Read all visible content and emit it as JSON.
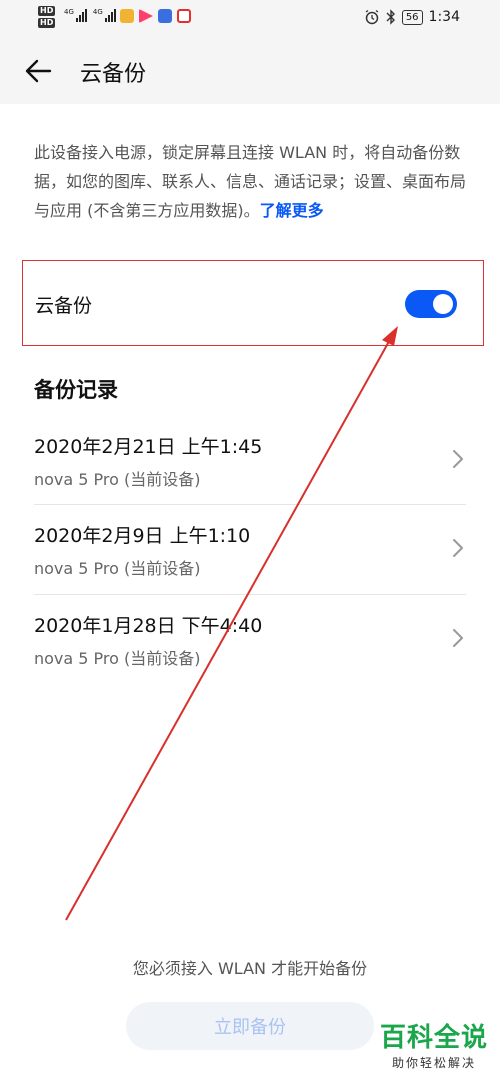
{
  "status_bar": {
    "hd_labels": [
      "HD",
      "HD"
    ],
    "network_labels": [
      "4G",
      "4G"
    ],
    "battery": "56",
    "time": "1:34",
    "icons": [
      "alarm-icon",
      "bluetooth-icon"
    ]
  },
  "header": {
    "title": "云备份",
    "back_icon": "arrow-left-icon"
  },
  "description": {
    "text": "此设备接入电源，锁定屏幕且连接 WLAN 时，将自动备份数据，如您的图库、联系人、信息、通话记录；设置、桌面布局与应用 (不含第三方应用数据)。",
    "link": "了解更多"
  },
  "cloud_toggle": {
    "label": "云备份",
    "enabled": true
  },
  "records": {
    "title": "备份记录",
    "items": [
      {
        "date": "2020年2月21日 上午1:45",
        "device": "nova 5 Pro (当前设备)"
      },
      {
        "date": "2020年2月9日 上午1:10",
        "device": "nova 5 Pro (当前设备)"
      },
      {
        "date": "2020年1月28日 下午4:40",
        "device": "nova 5 Pro (当前设备)"
      }
    ]
  },
  "footer": {
    "notice": "您必须接入 WLAN 才能开始备份",
    "button_label": "立即备份"
  },
  "watermark": {
    "main": "百科全说",
    "sub": "助你轻松解决"
  },
  "colors": {
    "accent": "#0a59f7",
    "highlight_border": "#dd3333",
    "annotation_arrow": "#d9302c",
    "watermark_green": "#1aa64a"
  }
}
